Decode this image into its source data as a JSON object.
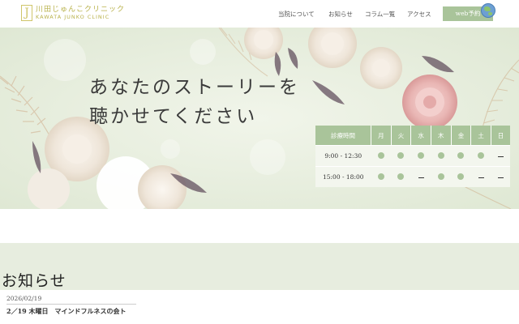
{
  "header": {
    "logo_mark": "J",
    "logo_jp": "川田じゅんこクリニック",
    "logo_en": "KAWATA JUNKO CLINIC",
    "nav": [
      "当院について",
      "お知らせ",
      "コラム一覧",
      "アクセス"
    ],
    "web_button": "web予約"
  },
  "hero": {
    "line1": "あなたのストーリーを",
    "line2": "聴かせてください"
  },
  "schedule": {
    "header": [
      "診療時間",
      "月",
      "火",
      "水",
      "木",
      "金",
      "土",
      "日"
    ],
    "rows": [
      {
        "time": "9:00 - 12:30",
        "marks": [
          "dot",
          "dot",
          "dot",
          "dot",
          "dot",
          "dot",
          "dash"
        ]
      },
      {
        "time": "15:00 - 18:00",
        "marks": [
          "dot",
          "dot",
          "dash",
          "dot",
          "dot",
          "dash",
          "dash"
        ]
      }
    ]
  },
  "news": {
    "title": "お知らせ",
    "items": [
      {
        "date": "2026/02/19",
        "title": "2／19 木曜日　マインドフルネスの会ト"
      }
    ]
  },
  "colors": {
    "accent": "#a9c49a",
    "logo_gold": "#cfc56a",
    "news_bg": "#e7eddf"
  }
}
